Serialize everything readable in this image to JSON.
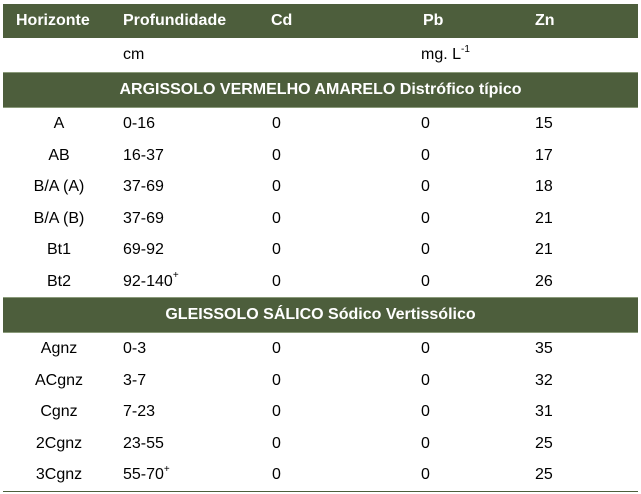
{
  "header": {
    "col1": "Horizonte",
    "col2": "Profundidade",
    "col3": "Cd",
    "col4": "Pb",
    "col5": "Zn"
  },
  "units": {
    "depth": "cm",
    "conc": "mg. L",
    "conc_sup": "-1"
  },
  "groups": [
    {
      "title": "ARGISSOLO VERMELHO AMARELO Distrófico típico",
      "rows": [
        {
          "horizonte": "A",
          "depth": "0-16",
          "depth_sup": "",
          "cd": "0",
          "pb": "0",
          "zn": "15"
        },
        {
          "horizonte": "AB",
          "depth": "16-37",
          "depth_sup": "",
          "cd": "0",
          "pb": "0",
          "zn": "17"
        },
        {
          "horizonte": "B/A (A)",
          "depth": "37-69",
          "depth_sup": "",
          "cd": "0",
          "pb": "0",
          "zn": "18"
        },
        {
          "horizonte": "B/A (B)",
          "depth": "37-69",
          "depth_sup": "",
          "cd": "0",
          "pb": "0",
          "zn": "21"
        },
        {
          "horizonte": "Bt1",
          "depth": "69-92",
          "depth_sup": "",
          "cd": "0",
          "pb": "0",
          "zn": "21"
        },
        {
          "horizonte": "Bt2",
          "depth": "92-140",
          "depth_sup": "+",
          "cd": "0",
          "pb": "0",
          "zn": "26"
        }
      ]
    },
    {
      "title": "GLEISSOLO SÁLICO Sódico Vertissólico",
      "rows": [
        {
          "horizonte": "Agnz",
          "depth": "0-3",
          "depth_sup": "",
          "cd": "0",
          "pb": "0",
          "zn": "35"
        },
        {
          "horizonte": "ACgnz",
          "depth": "3-7",
          "depth_sup": "",
          "cd": "0",
          "pb": "0",
          "zn": "32"
        },
        {
          "horizonte": "Cgnz",
          "depth": "7-23",
          "depth_sup": "",
          "cd": "0",
          "pb": "0",
          "zn": "31"
        },
        {
          "horizonte": "2Cgnz",
          "depth": "23-55",
          "depth_sup": "",
          "cd": "0",
          "pb": "0",
          "zn": "25"
        },
        {
          "horizonte": "3Cgnz",
          "depth": "55-70",
          "depth_sup": "+",
          "cd": "0",
          "pb": "0",
          "zn": "25"
        }
      ]
    }
  ],
  "colors": {
    "header_bg": "#4d5e3c",
    "header_text": "#ffffff"
  }
}
